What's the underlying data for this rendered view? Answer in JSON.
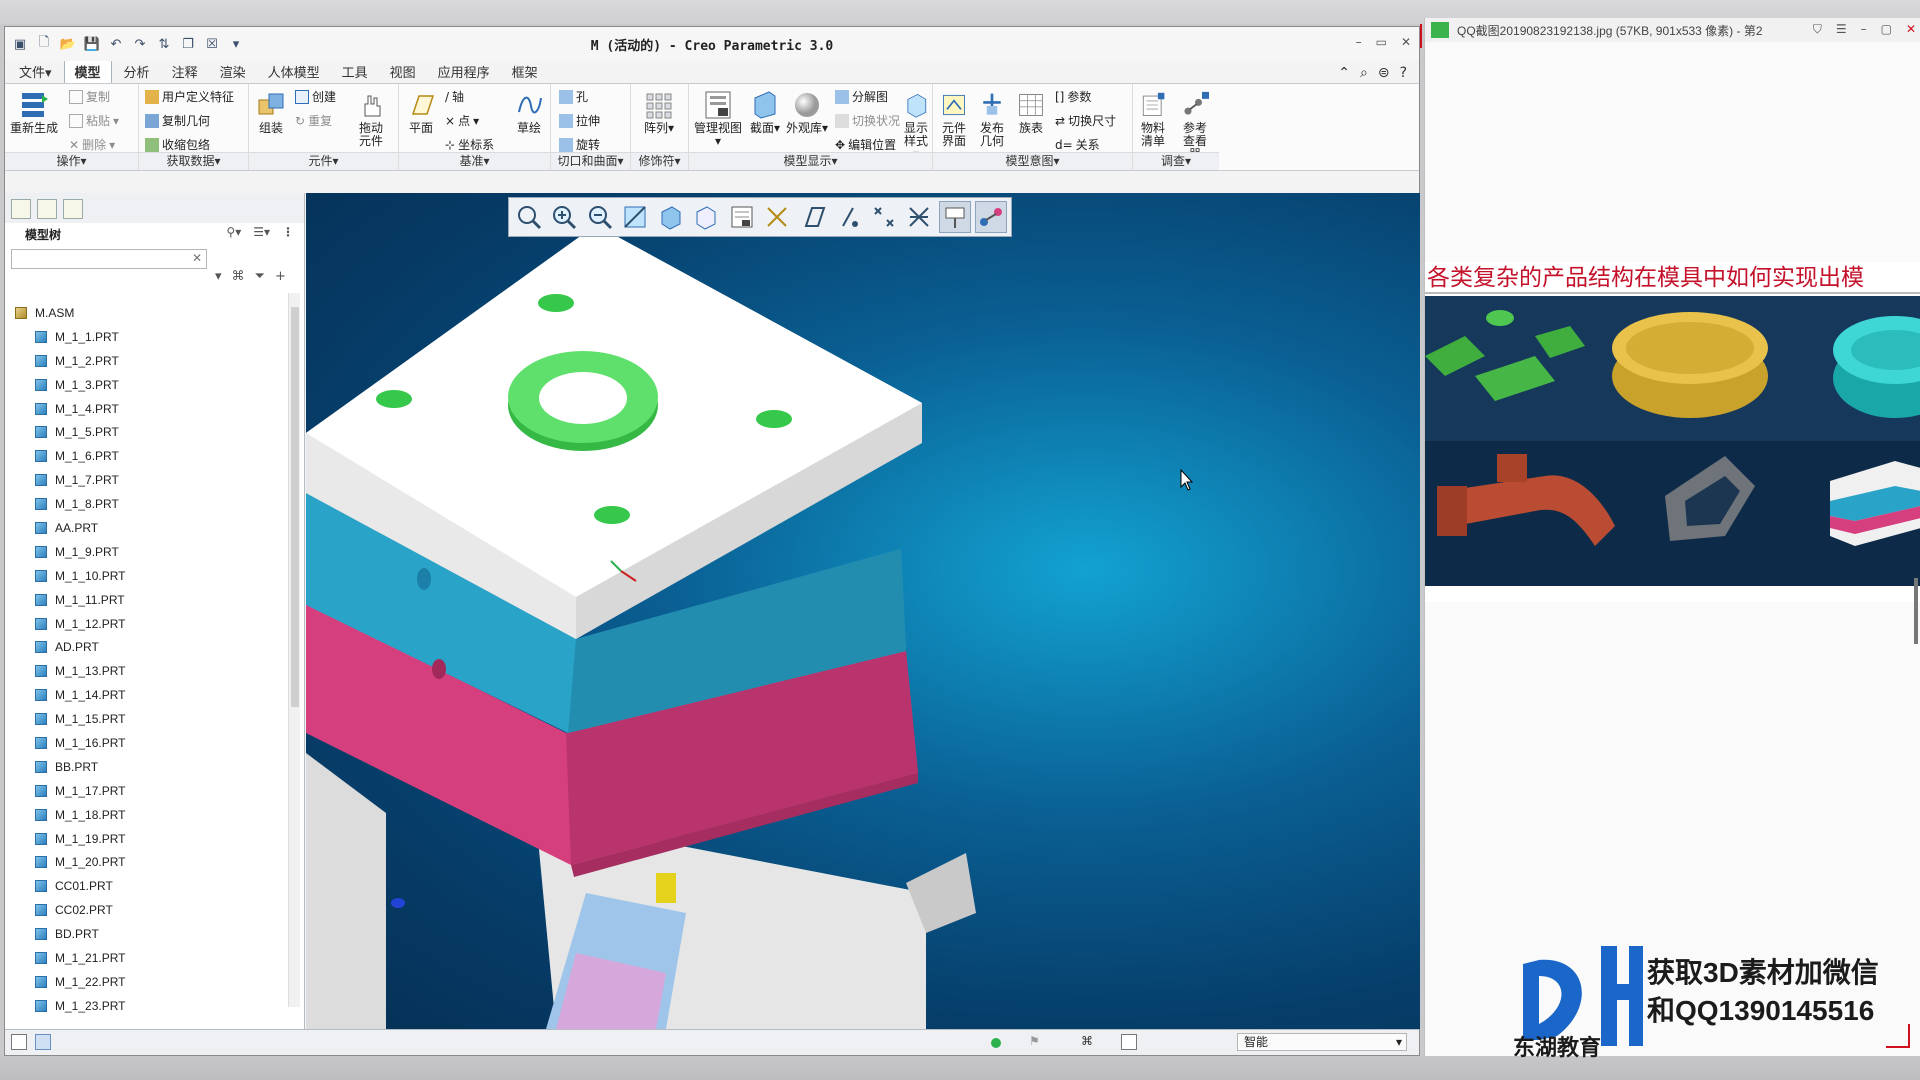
{
  "creo": {
    "title": "M (活动的) - Creo Parametric 3.0",
    "menu_tabs": [
      "文件▾",
      "模型",
      "分析",
      "注释",
      "渲染",
      "人体模型",
      "工具",
      "视图",
      "应用程序",
      "框架"
    ],
    "active_tab": "模型",
    "ribbon": {
      "operations": {
        "label": "操作▾",
        "regenerate": "重新生成",
        "copy": "复制",
        "paste": "粘贴",
        "delete": "删除"
      },
      "get_data": {
        "label": "获取数据▾",
        "udf": "用户定义特征",
        "copy_geometry": "复制几何",
        "shrinkwrap": "收缩包络"
      },
      "component": {
        "label": "元件▾",
        "assemble": "组装",
        "create": "创建",
        "repeat": "重复",
        "drag": "拖动元件"
      },
      "datum": {
        "label": "基准▾",
        "plane": "平面",
        "axis": "轴",
        "point": "点",
        "csys": "坐标系",
        "sketch": "草绘"
      },
      "cut_surface": {
        "label": "切口和曲面▾",
        "hole": "孔",
        "extrude": "拉伸",
        "revolve": "旋转"
      },
      "modifiers": {
        "label": "修饰符▾",
        "pattern": "阵列"
      },
      "model_display": {
        "label": "模型显示▾",
        "manage_views": "管理视图",
        "section": "截面",
        "appearance": "外观库",
        "exploded": "分解图",
        "toggle_status": "切换状况",
        "edit_position": "编辑位置",
        "display_style": "显示样式"
      },
      "model_intent": {
        "label": "模型意图▾",
        "component_interface": "元件界面",
        "publish_geometry": "发布几何",
        "family_table": "族表",
        "parameters": "参数",
        "switch_dimensions": "切换尺寸",
        "relations": "关系"
      },
      "investigate": {
        "label": "调查▾",
        "bom": "物料清单",
        "ref_viewer": "参考查看器"
      }
    },
    "model_tree": {
      "header": "模型树",
      "root": "M.ASM",
      "items": [
        "M_1_1.PRT",
        "M_1_2.PRT",
        "M_1_3.PRT",
        "M_1_4.PRT",
        "M_1_5.PRT",
        "M_1_6.PRT",
        "M_1_7.PRT",
        "M_1_8.PRT",
        "AA.PRT",
        "M_1_9.PRT",
        "M_1_10.PRT",
        "M_1_11.PRT",
        "M_1_12.PRT",
        "AD.PRT",
        "M_1_13.PRT",
        "M_1_14.PRT",
        "M_1_15.PRT",
        "M_1_16.PRT",
        "BB.PRT",
        "M_1_17.PRT",
        "M_1_18.PRT",
        "M_1_19.PRT",
        "M_1_20.PRT",
        "CC01.PRT",
        "CC02.PRT",
        "BD.PRT",
        "M_1_21.PRT",
        "M_1_22.PRT",
        "M_1_23.PRT"
      ]
    },
    "status": {
      "filter": "智能"
    }
  },
  "viewer": {
    "title": "QQ截图20190823192138.jpg (57KB, 901x533 像素) - 第2",
    "banner_title": "各类复杂的产品结构在模具中如何实现出模",
    "promo_line1": "获取3D素材加微信",
    "promo_line2": "和QQ1390145516",
    "brand": "东湖教育"
  },
  "colors": {
    "viewport_bg": "#0a5f93",
    "plate_top": "#ffffff",
    "plate_cyan": "#2aa3c8",
    "plate_pink": "#d63f7e",
    "accent_green": "#35c84a",
    "promo_red": "#c4122b"
  }
}
